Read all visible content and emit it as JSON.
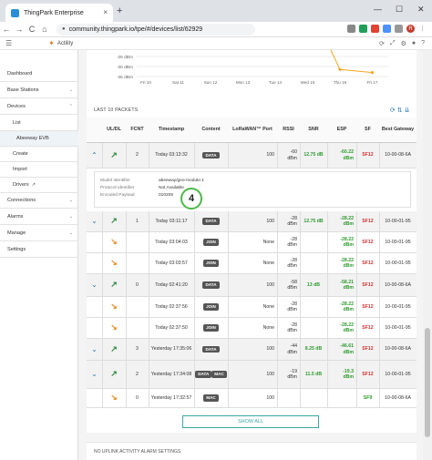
{
  "browser": {
    "tab_title": "ThingPark Enterprise",
    "tab_close": "×",
    "new_tab": "+",
    "url": "community.thingpark.io/tpe/#/devices/list/62929",
    "win_min": "—",
    "win_max": "☐",
    "win_close": "✕",
    "back": "←",
    "forward": "→",
    "reload": "C",
    "home": "⌂",
    "lock": "🔒"
  },
  "app": {
    "logo_text": "Actility",
    "menu_icon": "☰"
  },
  "sidebar": {
    "items": [
      {
        "label": "Dashboard",
        "caret": ""
      },
      {
        "label": "Base Stations",
        "caret": "⌄"
      },
      {
        "label": "Devices",
        "caret": "⌃"
      },
      {
        "label": "List",
        "caret": ""
      },
      {
        "label": "Abeeway EVB",
        "caret": ""
      },
      {
        "label": "Create",
        "caret": ""
      },
      {
        "label": "Import",
        "caret": ""
      },
      {
        "label": "Drivers",
        "caret": ""
      },
      {
        "label": "Connections",
        "caret": "⌄"
      },
      {
        "label": "Alarms",
        "caret": "⌄"
      },
      {
        "label": "Manage",
        "caret": "⌄"
      },
      {
        "label": "Settings",
        "caret": ""
      }
    ]
  },
  "chart_data": {
    "type": "line",
    "yticks": [
      "-25 dBm",
      "-30 dBm",
      "-35 dBm"
    ],
    "xticks": [
      "Fri 10",
      "Sat 11",
      "Sun 12",
      "Mon 13",
      "Tue 14",
      "Wed 15",
      "Thu 16",
      "Fri 17"
    ],
    "series": [
      {
        "color": "#f5a623"
      }
    ],
    "x": [
      "Thu 16",
      "Fri 17"
    ],
    "y": [
      -31.5,
      -33
    ]
  },
  "packets": {
    "title": "LAST 10 PACKETS",
    "icons": "⟳ ⇅ ⇊",
    "headers": [
      "UL/DL",
      "FCNT",
      "Timestamp",
      "Content",
      "LoRaWAN™ Port",
      "RSSI",
      "SNR",
      "ESP",
      "SF",
      "Best Gateway"
    ],
    "rows": [
      {
        "chev": "⌃",
        "dir": "up",
        "fcnt": "2",
        "ts": "Today 03:13:32",
        "content": [
          "DATA"
        ],
        "port": "100",
        "rssi": "-60 dBm",
        "snr": "12.75 dB",
        "esp": "-60.22 dBm",
        "sf": "SF12",
        "gw": "10-00-08-6A"
      },
      {
        "chev": "⌄",
        "dir": "up",
        "fcnt": "1",
        "ts": "Today 03:11:17",
        "content": [
          "DATA"
        ],
        "port": "100",
        "rssi": "-28 dBm",
        "snr": "12.75 dB",
        "esp": "-28.22 dBm",
        "sf": "SF12",
        "gw": "10-00-01-95"
      },
      {
        "chev": "",
        "dir": "down",
        "fcnt": "",
        "ts": "Today 03:04:03",
        "content": [
          "JOIN"
        ],
        "port": "None",
        "rssi": "-28 dBm",
        "snr": "",
        "esp": "-28.22 dBm",
        "sf": "SF12",
        "gw": "10-00-01-95"
      },
      {
        "chev": "",
        "dir": "down",
        "fcnt": "",
        "ts": "Today 03:03:57",
        "content": [
          "JOIN"
        ],
        "port": "None",
        "rssi": "-28 dBm",
        "snr": "",
        "esp": "-28.22 dBm",
        "sf": "SF12",
        "gw": "10-00-01-95"
      },
      {
        "chev": "⌄",
        "dir": "up",
        "fcnt": "0",
        "ts": "Today 02:41:20",
        "content": [
          "DATA"
        ],
        "port": "100",
        "rssi": "-58 dBm",
        "snr": "13 dB",
        "esp": "-58.21 dBm",
        "sf": "SF12",
        "gw": "10-00-08-6A"
      },
      {
        "chev": "",
        "dir": "down",
        "fcnt": "",
        "ts": "Today 02:37:56",
        "content": [
          "JOIN"
        ],
        "port": "None",
        "rssi": "-28 dBm",
        "snr": "",
        "esp": "-28.22 dBm",
        "sf": "SF12",
        "gw": "10-00-01-95"
      },
      {
        "chev": "",
        "dir": "down",
        "fcnt": "",
        "ts": "Today 02:37:50",
        "content": [
          "JOIN"
        ],
        "port": "None",
        "rssi": "-28 dBm",
        "snr": "",
        "esp": "-28.22 dBm",
        "sf": "SF12",
        "gw": "10-00-01-95"
      },
      {
        "chev": "⌄",
        "dir": "up",
        "fcnt": "3",
        "ts": "Yesterday 17:35:06",
        "content": [
          "DATA"
        ],
        "port": "100",
        "rssi": "-44 dBm",
        "snr": "8.25 dB",
        "esp": "-46.61 dBm",
        "sf": "SF12",
        "gw": "10-00-08-6A"
      },
      {
        "chev": "⌄",
        "dir": "up",
        "fcnt": "2",
        "ts": "Yesterday 17:34:08",
        "content": [
          "DATA",
          "MAC"
        ],
        "port": "100",
        "rssi": "-19 dBm",
        "snr": "11.5 dB",
        "esp": "-19.3 dBm",
        "sf": "SF12",
        "gw": "10-00-01-95"
      },
      {
        "chev": "",
        "dir": "down",
        "fcnt": "0",
        "ts": "Yesterday 17:32:57",
        "content": [
          "MAC"
        ],
        "port": "100",
        "rssi": "",
        "snr": "",
        "esp": "",
        "sf": "SF9",
        "gw": "10-00-08-6A"
      }
    ]
  },
  "detail": {
    "model_label": "Model Identifier",
    "model_value": "abeeway/geo-module:1",
    "proto_label": "Protocol Identifier",
    "proto_value": "Not Available",
    "payload_label": "Encoded Payload",
    "payload_value": "010205",
    "step": "4"
  },
  "show_all": "SHOW ALL",
  "no_activity": "NO UPLINK ACTIVITY ALARM SETTINGS",
  "colors": {
    "accent": "#3aa6a0",
    "up": "#2e8b3e",
    "down": "#e88a1e",
    "sf": "#d03030",
    "good": "#2e9b2e"
  }
}
